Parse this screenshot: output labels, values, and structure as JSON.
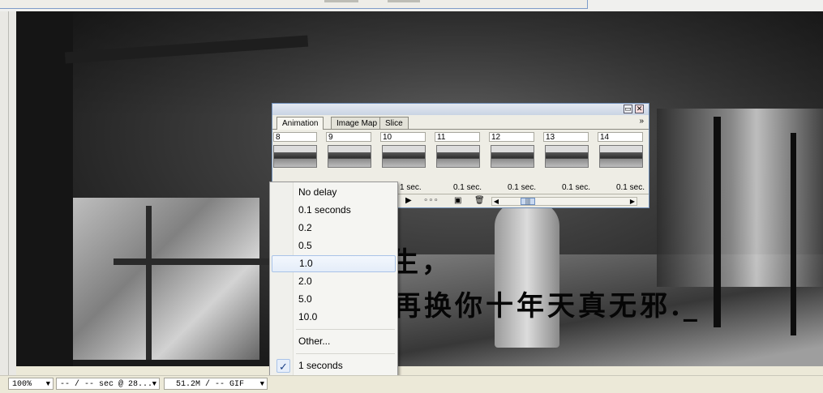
{
  "document": {
    "text_line1": "生，",
    "text_line2": "再换你十年天真无邪._"
  },
  "animation_panel": {
    "title_buttons": {
      "minimize": "▭",
      "close": "✕"
    },
    "tabs": [
      {
        "label": "Animation",
        "active": true
      },
      {
        "label": "Image Map",
        "active": false
      },
      {
        "label": "Slice",
        "active": false
      }
    ],
    "expand_label": "»",
    "frames": [
      {
        "number": "8",
        "delay": ""
      },
      {
        "number": "9",
        "delay": ""
      },
      {
        "number": "10",
        "delay": "1 sec."
      },
      {
        "number": "11",
        "delay": "0.1 sec."
      },
      {
        "number": "12",
        "delay": "0.1 sec."
      },
      {
        "number": "13",
        "delay": "0.1 sec."
      },
      {
        "number": "14",
        "delay": "0.1 sec."
      }
    ],
    "controls": {
      "play": "▶",
      "tween": "∘∘∘",
      "new_frame": "▣",
      "delete": "🗑",
      "scroll_left": "◀",
      "scroll_right": "▶",
      "scroll_thumb": "|||"
    }
  },
  "delay_menu": {
    "items": [
      {
        "label": "No delay",
        "highlighted": false
      },
      {
        "label": "0.1 seconds",
        "highlighted": false
      },
      {
        "label": "0.2",
        "highlighted": false
      },
      {
        "label": "0.5",
        "highlighted": false
      },
      {
        "label": "1.0",
        "highlighted": true
      },
      {
        "label": "2.0",
        "highlighted": false
      },
      {
        "label": "5.0",
        "highlighted": false
      },
      {
        "label": "10.0",
        "highlighted": false
      }
    ],
    "other_label": "Other...",
    "current_label": "1 seconds",
    "check_glyph": "✓"
  },
  "status_bar": {
    "zoom": "100%",
    "timing": "-- / -- sec @ 28...",
    "size": "51.2M / -- GIF",
    "dropdown_glyph": "▼"
  },
  "colors": {
    "menu_highlight_border": "#a9c3e8",
    "panel_border": "#6f8fb9"
  }
}
